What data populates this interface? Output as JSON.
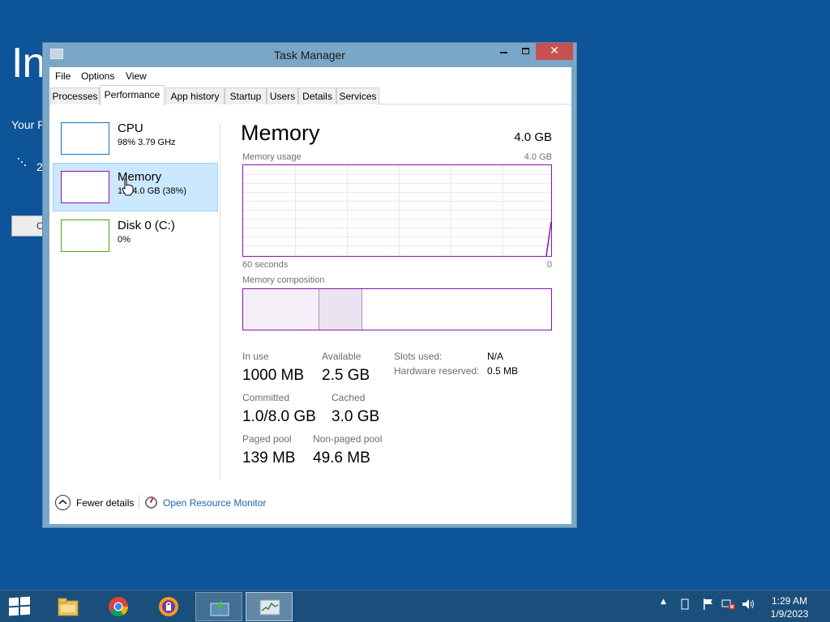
{
  "background": {
    "title": "In",
    "subtitle": "Your P",
    "progress": "2",
    "button_label": "C"
  },
  "window": {
    "title": "Task Manager",
    "close_glyph": "✕"
  },
  "menu": [
    "File",
    "Options",
    "View"
  ],
  "tabs": [
    {
      "label": "Processes",
      "active": false
    },
    {
      "label": "Performance",
      "active": true
    },
    {
      "label": "App history",
      "active": false
    },
    {
      "label": "Startup",
      "active": false
    },
    {
      "label": "Users",
      "active": false
    },
    {
      "label": "Details",
      "active": false
    },
    {
      "label": "Services",
      "active": false
    }
  ],
  "resources": [
    {
      "name": "CPU",
      "detail": "98%  3.79 GHz",
      "color": "#1170c5",
      "selected": false
    },
    {
      "name": "Memory",
      "detail": "1.0/4.0 GB (38%)",
      "color": "#8b12ae",
      "selected": true
    },
    {
      "name": "Disk 0 (C:)",
      "detail": "0%",
      "color": "#4da60c",
      "selected": false
    }
  ],
  "memory": {
    "title": "Memory",
    "total": "4.0 GB",
    "usage_label": "Memory usage",
    "usage_max": "4.0 GB",
    "time_left": "60 seconds",
    "time_right": "0",
    "composition_label": "Memory composition",
    "stats": {
      "in_use": {
        "label": "In use",
        "value": "1000 MB"
      },
      "available": {
        "label": "Available",
        "value": "2.5 GB"
      },
      "committed": {
        "label": "Committed",
        "value": "1.0/8.0 GB"
      },
      "cached": {
        "label": "Cached",
        "value": "3.0 GB"
      },
      "paged_pool": {
        "label": "Paged pool",
        "value": "139 MB"
      },
      "non_paged_pool": {
        "label": "Non-paged pool",
        "value": "49.6 MB"
      }
    },
    "side": {
      "slots_label": "Slots used:",
      "slots_value": "N/A",
      "hw_label": "Hardware reserved:",
      "hw_value": "0.5 MB"
    }
  },
  "footer": {
    "fewer_details": "Fewer details",
    "open_resource_monitor": "Open Resource Monitor"
  },
  "taskbar": {
    "items": [
      "start-button",
      "file-explorer-icon",
      "chrome-icon",
      "browser-icon",
      "setup-icon",
      "task-manager-icon"
    ],
    "time": "1:29 AM",
    "date": "1/9/2023"
  },
  "colors": {
    "desktop": "#0d5499",
    "memory_accent": "#8b12ae",
    "cpu_accent": "#1170c5",
    "disk_accent": "#4da60c",
    "link": "#1a64ab",
    "selection": "#cce8ff"
  }
}
